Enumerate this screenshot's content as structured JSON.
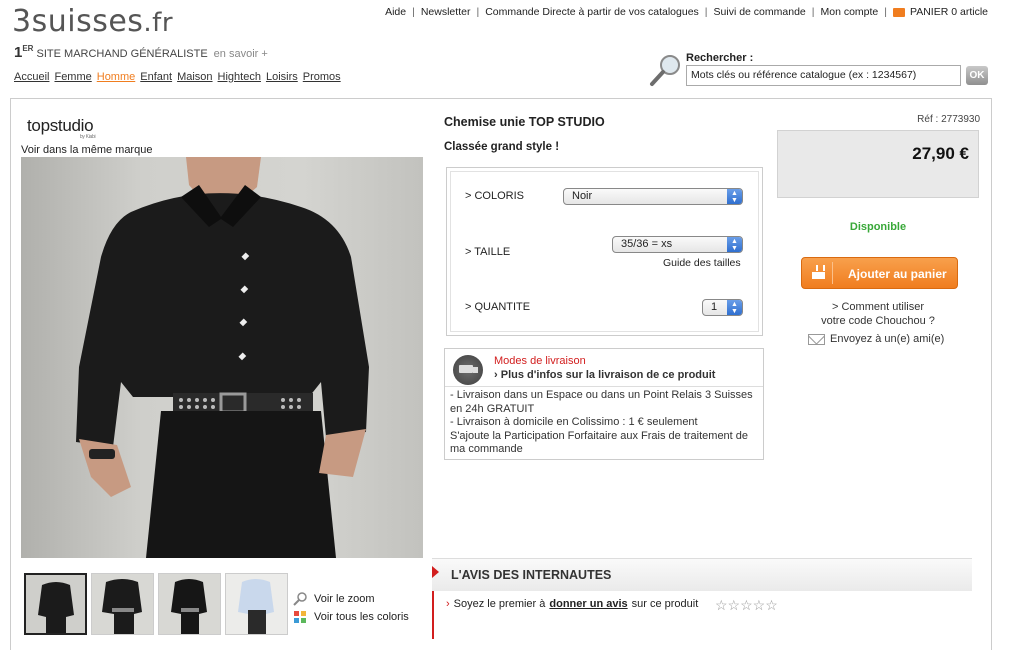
{
  "header": {
    "logo": "3suisses",
    "logo_suffix": ".fr",
    "tagline_big": "1",
    "tagline_er": "ER",
    "tagline_rest": " SITE MARCHAND GÉNÉRALISTE",
    "tagline_link": "en savoir +",
    "top_links": [
      "Aide",
      "Newsletter",
      "Commande Directe à partir de vos catalogues",
      "Suivi de commande",
      "Mon compte"
    ],
    "cart": "PANIER 0 article",
    "nav": [
      "Accueil",
      "Femme",
      "Homme",
      "Enfant",
      "Maison",
      "Hightech",
      "Loisirs",
      "Promos"
    ],
    "nav_active": "Homme",
    "search_label": "Rechercher :",
    "search_placeholder": "Mots clés ou référence catalogue (ex : 1234567)",
    "search_ok": "OK"
  },
  "product": {
    "brand": "topstudio",
    "brand_small": "by Kiabi",
    "brand_link": "Voir dans la même marque",
    "title": "Chemise unie TOP STUDIO",
    "subtitle": "Classée grand style !",
    "ref": "Réf : 2773930",
    "price": "27,90 €",
    "availability": "Disponible",
    "add_to_cart": "Ajouter au panier",
    "chouchou_line1": "> Comment utiliser",
    "chouchou_line2": "votre code Chouchou ?",
    "send_friend": "Envoyez à un(e) ami(e)",
    "options": {
      "color_label": "> COLORIS",
      "color_value": "Noir",
      "size_label": "> TAILLE",
      "size_value": "35/36 = xs",
      "size_guide": "Guide des tailles",
      "qty_label": "> QUANTITE",
      "qty_value": "1"
    },
    "zoom_link": "Voir le zoom",
    "colors_link": "Voir tous les coloris"
  },
  "delivery": {
    "title": "Modes de livraison",
    "more": "Plus d'infos sur la livraison de ce produit",
    "line1": "- Livraison dans un Espace ou dans un Point Relais 3 Suisses en 24h GRATUIT",
    "line2": "- Livraison à domicile en Colissimo : 1 € seulement",
    "line3": "S'ajoute la Participation Forfaitaire aux Frais de traitement de ma commande"
  },
  "reviews": {
    "title": "L'AVIS DES INTERNAUTES",
    "prefix": "Soyez le premier à",
    "link": "donner un avis",
    "suffix": "sur ce produit",
    "stars": "☆☆☆☆☆"
  },
  "colors": {
    "accent": "#f07d1f",
    "red": "#d21e1e",
    "green": "#38a838"
  }
}
